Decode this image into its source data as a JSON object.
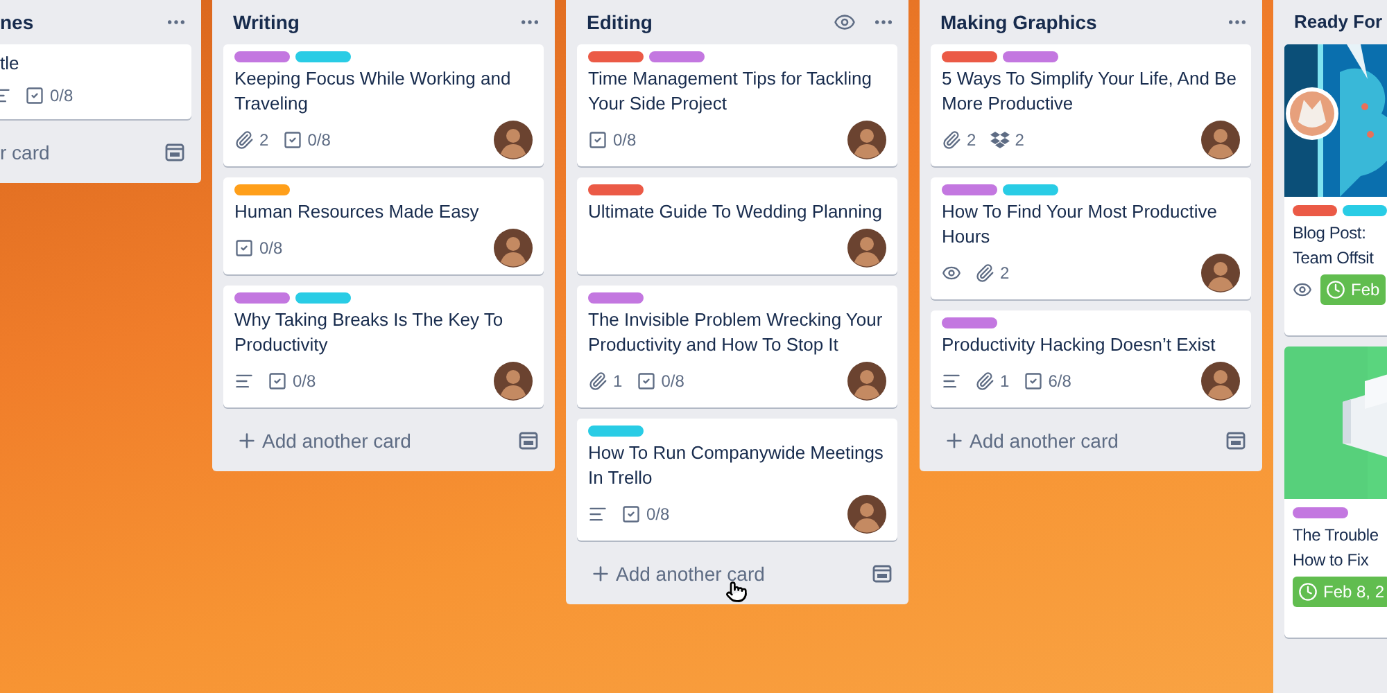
{
  "lists": [
    {
      "kind": "cut-left",
      "title": "nes",
      "cards": [
        {
          "title": "tle",
          "badges": [
            {
              "kind": "description"
            },
            {
              "kind": "checklist",
              "text": "0/8"
            }
          ]
        }
      ],
      "add_label": "r card"
    },
    {
      "kind": "full",
      "title": "Writing",
      "watched": false,
      "cards": [
        {
          "title": "Keeping Focus While Working and Traveling",
          "labels": [
            {
              "color": "#c377e0"
            },
            {
              "color": "#29cce5"
            }
          ],
          "avatar": true,
          "badges": [
            {
              "kind": "attachment",
              "text": "2"
            },
            {
              "kind": "checklist",
              "text": "0/8"
            }
          ]
        },
        {
          "title": "Human Resources Made Easy",
          "labels": [
            {
              "color": "#ff9f1a"
            }
          ],
          "avatar": true,
          "badges": [
            {
              "kind": "checklist",
              "text": "0/8"
            }
          ]
        },
        {
          "title": "Why Taking Breaks Is The Key To Productivity",
          "labels": [
            {
              "color": "#c377e0"
            },
            {
              "color": "#29cce5"
            }
          ],
          "avatar": true,
          "badges": [
            {
              "kind": "description"
            },
            {
              "kind": "checklist",
              "text": "0/8"
            }
          ]
        }
      ],
      "add_label": "Add another card"
    },
    {
      "kind": "full",
      "title": "Editing",
      "watched": true,
      "cursor": true,
      "cards": [
        {
          "title": "Time Management Tips for Tackling Your Side Project",
          "labels": [
            {
              "color": "#eb5a46"
            },
            {
              "color": "#c377e0"
            }
          ],
          "avatar": true,
          "badges": [
            {
              "kind": "checklist",
              "text": "0/8"
            }
          ]
        },
        {
          "title": "Ultimate Guide To Wedding Planning",
          "labels": [
            {
              "color": "#eb5a46"
            }
          ],
          "avatar": true
        },
        {
          "title": "The Invisible Problem Wrecking Your Productivity and How To Stop It",
          "labels": [
            {
              "color": "#c377e0"
            }
          ],
          "avatar": true,
          "badges": [
            {
              "kind": "attachment",
              "text": "1"
            },
            {
              "kind": "checklist",
              "text": "0/8"
            }
          ]
        },
        {
          "title": "How To Run Companywide Meetings In Trello",
          "labels": [
            {
              "color": "#29cce5"
            }
          ],
          "avatar": true,
          "badges": [
            {
              "kind": "description"
            },
            {
              "kind": "checklist",
              "text": "0/8"
            }
          ]
        }
      ],
      "add_label": "Add another card"
    },
    {
      "kind": "full",
      "title": "Making Graphics",
      "watched": false,
      "cards": [
        {
          "title": "5 Ways To Simplify Your Life, And Be More Productive",
          "labels": [
            {
              "color": "#eb5a46"
            },
            {
              "color": "#c377e0"
            }
          ],
          "avatar": true,
          "badges": [
            {
              "kind": "attachment",
              "text": "2"
            },
            {
              "kind": "dropbox",
              "text": "2"
            }
          ]
        },
        {
          "title": "How To Find Your Most Productive Hours",
          "labels": [
            {
              "color": "#c377e0"
            },
            {
              "color": "#29cce5"
            }
          ],
          "avatar": true,
          "badges": [
            {
              "kind": "watch"
            },
            {
              "kind": "attachment",
              "text": "2"
            }
          ]
        },
        {
          "title": "Productivity Hacking Doesn’t Exist",
          "labels": [
            {
              "color": "#c377e0"
            }
          ],
          "avatar": true,
          "badges": [
            {
              "kind": "description"
            },
            {
              "kind": "attachment",
              "text": "1"
            },
            {
              "kind": "checklist",
              "text": "6/8"
            }
          ]
        }
      ],
      "add_label": "Add another card"
    },
    {
      "kind": "cut-right",
      "title": "Ready For",
      "cards": [
        {
          "cover": {
            "kind": "picture"
          },
          "title_lines": [
            "Blog Post:",
            "Team Offsit"
          ],
          "labels": [
            {
              "color": "#eb5a46"
            },
            {
              "color": "#29cce5"
            }
          ],
          "badges": [
            {
              "kind": "watch"
            },
            {
              "kind": "due",
              "text": "Feb"
            }
          ]
        },
        {
          "cover": {
            "kind": "picture"
          },
          "title_lines": [
            "The Trouble",
            "How to Fix"
          ],
          "labels": [
            {
              "color": "#c377e0"
            }
          ],
          "badges": [
            {
              "kind": "due",
              "text": "Feb 8, 2"
            }
          ]
        }
      ]
    }
  ]
}
